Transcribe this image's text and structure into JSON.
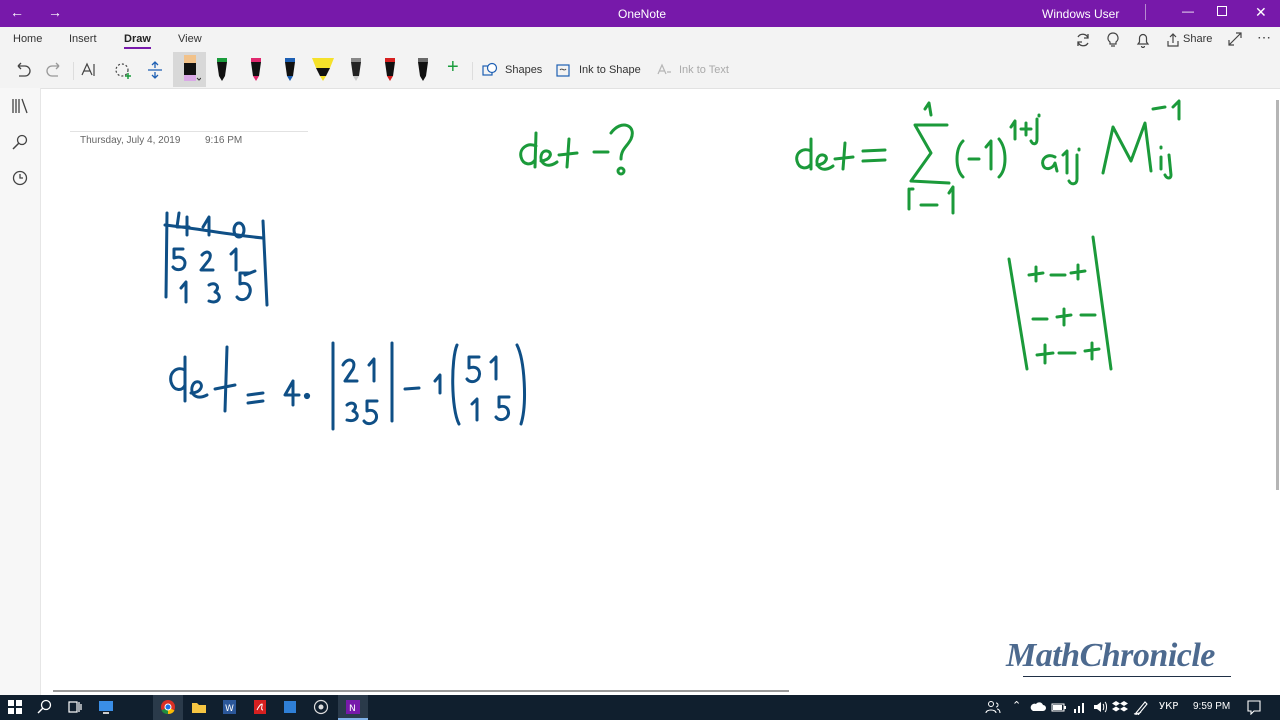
{
  "window": {
    "app_title": "OneNote",
    "user": "Windows User"
  },
  "tabs": [
    "Home",
    "Insert",
    "Draw",
    "View"
  ],
  "actions": {
    "share": "Share"
  },
  "toolbar": {
    "shapes": "Shapes",
    "ink_to_shape": "Ink to Shape",
    "ink_to_text": "Ink to Text",
    "pen_colors": [
      "#111111",
      "#1a9c3c",
      "#e0286e",
      "#1d5fb3",
      "#f5e12a",
      "#222222",
      "#d62020",
      "#222222"
    ]
  },
  "page": {
    "date": "Thursday, July 4, 2019",
    "time": "9:16 PM"
  },
  "watermark": "MathChronicle",
  "taskbar": {
    "lang": "УКР",
    "clock": "9:59 PM"
  }
}
